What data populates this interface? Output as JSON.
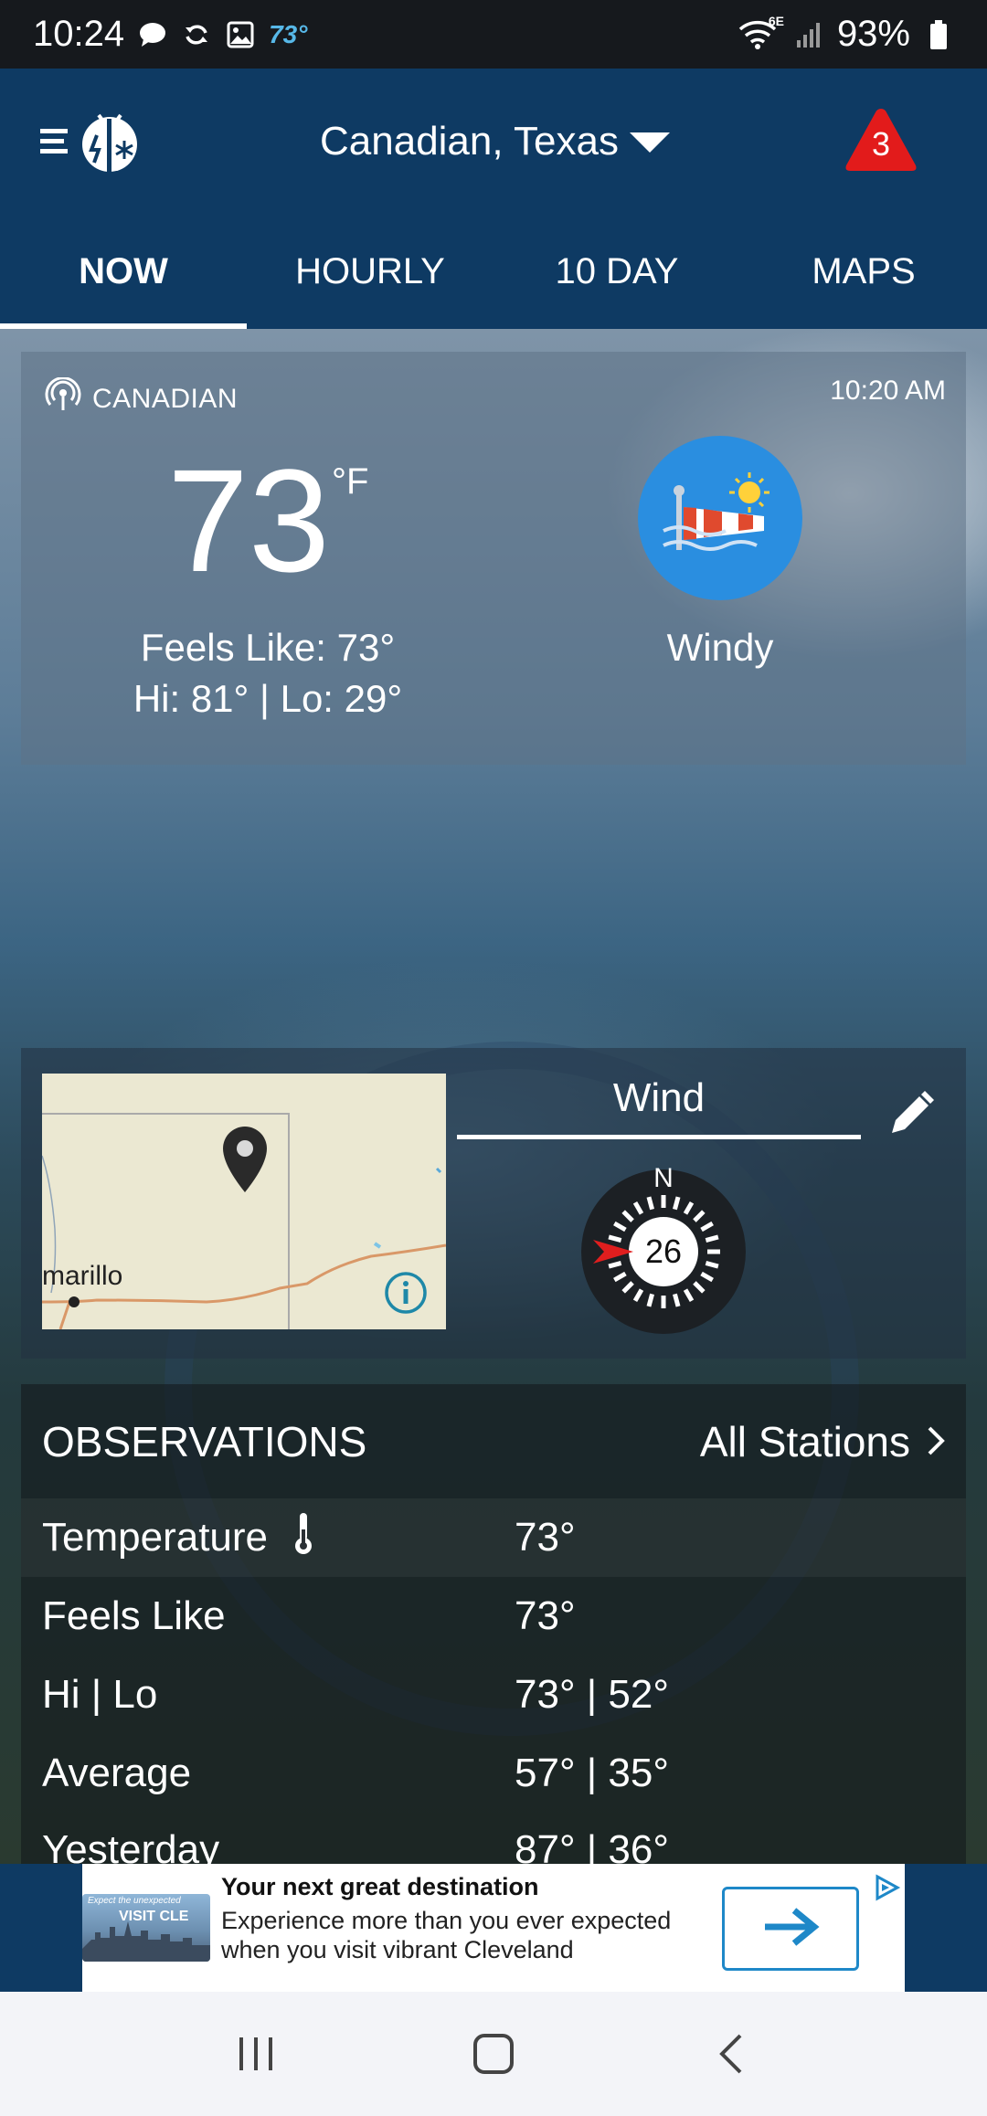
{
  "status_bar": {
    "time": "10:24",
    "weather_temp": "73°",
    "network": "6E",
    "battery": "93%"
  },
  "header": {
    "location": "Canadian, Texas",
    "alert_count": "3"
  },
  "tabs": [
    {
      "label": "NOW",
      "active": true
    },
    {
      "label": "HOURLY",
      "active": false
    },
    {
      "label": "10 DAY",
      "active": false
    },
    {
      "label": "MAPS",
      "active": false
    }
  ],
  "current": {
    "station": "CANADIAN",
    "time": "10:20 AM",
    "temperature": "73",
    "unit": "°F",
    "feels_like": "Feels Like: 73°",
    "hi_lo": "Hi: 81° | Lo: 29°",
    "condition": "Windy",
    "condition_icon": "windsock-icon"
  },
  "map": {
    "city_label": "marillo"
  },
  "wind": {
    "title": "Wind",
    "compass_north": "N",
    "speed": "26"
  },
  "observations": {
    "title": "OBSERVATIONS",
    "all_stations": "All Stations",
    "rows": [
      {
        "label": "Temperature",
        "value": "73°"
      },
      {
        "label": "Feels Like",
        "value": "73°"
      },
      {
        "label": "Hi | Lo",
        "value": "73° | 52°"
      },
      {
        "label": "Average",
        "value": "57° | 35°"
      },
      {
        "label": "Yesterday",
        "value": "87° | 36°"
      }
    ]
  },
  "ad": {
    "thumb_tagline": "Expect the unexpected",
    "thumb_brand": "VISIT CLE",
    "title": "Your next great destination",
    "body": "Experience more than you ever expected when you visit vibrant Cleveland"
  },
  "colors": {
    "header_bg": "#0e3a63",
    "status_bar_bg": "#16191d",
    "alert_red": "#e21b1b",
    "condition_blue": "#2a8ee0",
    "ad_accent": "#1e88c8"
  }
}
